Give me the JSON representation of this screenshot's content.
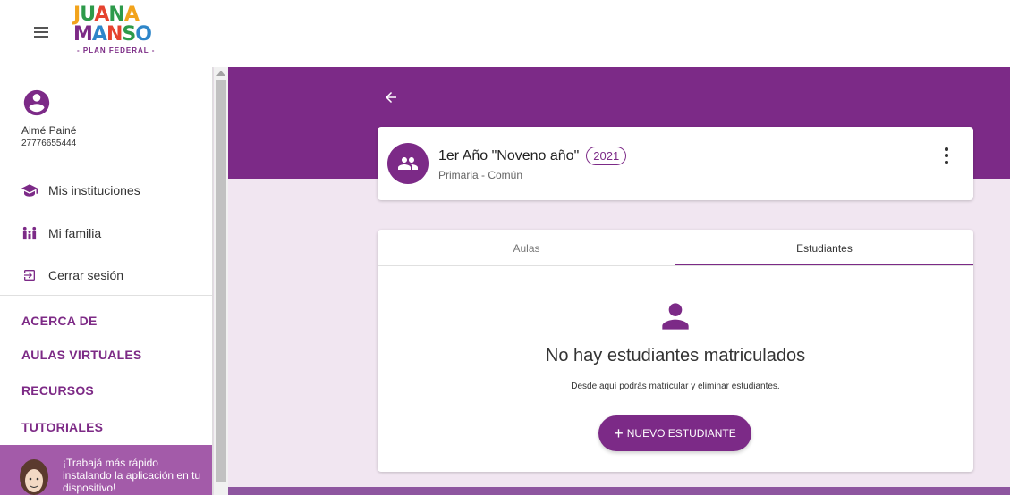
{
  "header": {
    "logo_line1": "JUANA",
    "logo_line2": "MANSO",
    "logo_sub": "- PLAN FEDERAL -",
    "menu_icon": "hamburger-icon"
  },
  "sidebar": {
    "user_name": "Aimé Painé",
    "user_id": "27776655444",
    "nav": [
      {
        "label": "Mis instituciones",
        "icon": "graduation-cap-icon"
      },
      {
        "label": "Mi familia",
        "icon": "family-icon"
      },
      {
        "label": "Cerrar sesión",
        "icon": "logout-icon"
      }
    ],
    "sections": [
      "ACERCA DE",
      "AULAS VIRTUALES",
      "RECURSOS",
      "TUTORIALES"
    ],
    "install_text": "¡Trabajá más rápido instalando la aplicación en tu dispositivo!"
  },
  "course": {
    "title": "1er Año \"Noveno año\"",
    "year": "2021",
    "subtitle": "Primaria - Común"
  },
  "tabs": [
    {
      "label": "Aulas",
      "active": false
    },
    {
      "label": "Estudiantes",
      "active": true
    }
  ],
  "empty_state": {
    "title": "No hay estudiantes matriculados",
    "description": "Desde aquí podrás matricular y eliminar estudiantes.",
    "button_plus": "+",
    "button_label": "NUEVO ESTUDIANTE"
  },
  "colors": {
    "primary": "#7c2a87",
    "background": "#f1e6f1",
    "install_banner": "#a35ba9"
  }
}
